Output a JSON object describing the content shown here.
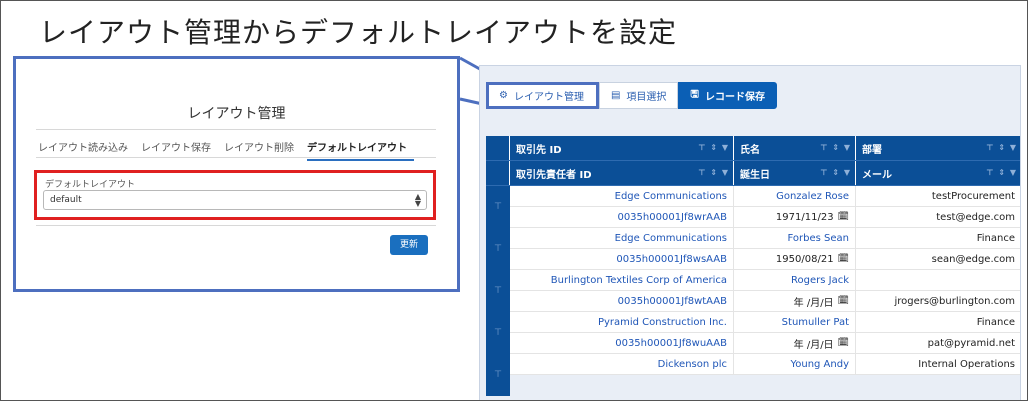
{
  "heading": "レイアウト管理からデフォルトレイアウトを設定",
  "dialog": {
    "title": "レイアウト管理",
    "tabs": [
      {
        "label": "レイアウト読み込み",
        "active": false
      },
      {
        "label": "レイアウト保存",
        "active": false
      },
      {
        "label": "レイアウト削除",
        "active": false
      },
      {
        "label": "デフォルトレイアウト",
        "active": true
      }
    ],
    "field_label": "デフォルトレイアウト",
    "field_value": "default",
    "update_label": "更新"
  },
  "toolbar": {
    "layout_label": "レイアウト管理",
    "items_label": "項目選択",
    "save_label": "レコード保存"
  },
  "grid": {
    "header_row1": [
      "取引先 ID",
      "氏名",
      "部署"
    ],
    "header_row2": [
      "取引先責任者 ID",
      "誕生日",
      "メール"
    ],
    "rows": [
      [
        "Edge Communications",
        "Gonzalez Rose",
        "testProcurement"
      ],
      [
        "0035h00001Jf8wrAAB",
        "1971/11/23",
        "test@edge.com"
      ],
      [
        "Edge Communications",
        "Forbes Sean",
        "Finance"
      ],
      [
        "0035h00001Jf8wsAAB",
        "1950/08/21",
        "sean@edge.com"
      ],
      [
        "Burlington Textiles Corp of America",
        "Rogers Jack",
        ""
      ],
      [
        "0035h00001Jf8wtAAB",
        "年 /月/日",
        "jrogers@burlington.com"
      ],
      [
        "Pyramid Construction Inc.",
        "Stumuller Pat",
        "Finance"
      ],
      [
        "0035h00001Jf8wuAAB",
        "年 /月/日",
        "pat@pyramid.net"
      ],
      [
        "Dickenson plc",
        "Young Andy",
        "Internal Operations"
      ]
    ]
  },
  "colors": {
    "header_bg": "#0b4f97",
    "highlight_blue": "#4d6fbf",
    "highlight_red": "#e02020",
    "link": "#1f56b7"
  }
}
